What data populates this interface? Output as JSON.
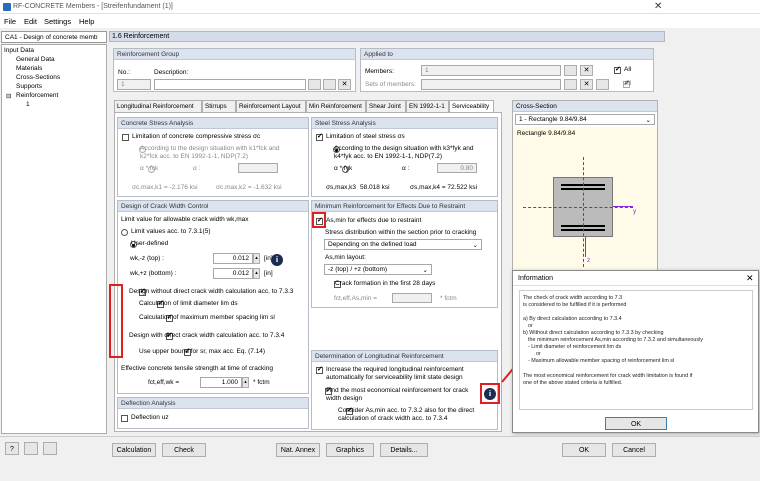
{
  "window": {
    "title": "RF-CONCRETE Members - [Streifenfundament (1)]"
  },
  "menu": [
    "File",
    "Edit",
    "Settings",
    "Help"
  ],
  "nav": {
    "case": "CA1 - Design of concrete memb",
    "tree": [
      "Input Data",
      "General Data",
      "Materials",
      "Cross-Sections",
      "Supports",
      "Reinforcement",
      "1"
    ]
  },
  "header": "1.6 Reinforcement",
  "reinf_group": {
    "title": "Reinforcement Group",
    "no_label": "No.:",
    "desc_label": "Description:",
    "no_value": "1"
  },
  "applied": {
    "title": "Applied to",
    "members_label": "Members:",
    "members_value": "1",
    "sets_label": "Sets of members:",
    "all1": "All",
    "all2": "All"
  },
  "tabs": [
    "Longitudinal Reinforcement",
    "Stirrups",
    "Reinforcement Layout",
    "Min Reinforcement",
    "Shear Joint",
    "EN 1992-1-1",
    "Serviceability"
  ],
  "ccs": {
    "title": "Concrete Stress Analysis",
    "limit": "Limitation of concrete compressive stress σc",
    "opt1a": "According to the design situation with k1*fck and",
    "opt1b": "k2*fck acc. to EN 1992-1-1, NDP(7.2)",
    "opt2": "α * fck",
    "alpha": "α :",
    "smax1": "σc,max,k1 = -2.176 ksi",
    "smax2": "σc,max,k2 = -1.632 ksi"
  },
  "ssa": {
    "title": "Steel Stress Analysis",
    "limit": "Limitation of steel stress σs",
    "opt1a": "According to the design situation with k3*fyk and",
    "opt1b": "k4*fyk acc. to EN 1992-1-1, NDP(7.2)",
    "opt2": "α * fyk",
    "alpha": "α :",
    "alpha_val": "0.80",
    "smax1": "σs,max,k3",
    "smax1v": "58.018 ksi",
    "smax2": "σs,max,k4 = 72.522 ksi"
  },
  "dcw": {
    "title": "Design of Crack Width Control",
    "limit": "Limit value for allowable crack width wk,max",
    "opt1": "Limit values acc. to 7.3.1(5)",
    "opt2": "User-defined",
    "wtop": "wk,-z (top) :",
    "wtop_v": "0.012",
    "wbot": "wk,+z (bottom) :",
    "wbot_v": "0.012",
    "unit": "[in]",
    "d1": "Design without direct crack width calculation acc. to 7.3.3",
    "d1a": "Calculation of limit diameter lim ds",
    "d1b": "Calculation of maximum member spacing lim sl",
    "d2": "Design with direct crack width calculation acc. to 7.3.4",
    "d2a": "Use upper bound for sr, max acc. Eq. (7.14)",
    "tensile": "Effective concrete tensile strength at time of cracking",
    "fct": "fct,eff,wk =",
    "fct_v": "1.000",
    "fctm": "* fctm"
  },
  "defl": {
    "title": "Deflection Analysis",
    "chk": "Deflection uz"
  },
  "minr": {
    "title": "Minimum Reinforcement for Effects Due to Restraint",
    "chk": "As,min for effects due to restraint",
    "dist": "Stress distribution within the section prior to cracking",
    "dist_v": "Depending on the defined load",
    "layout": "As,min layout:",
    "layout_v": "-z (top) / +z (bottom)",
    "crack28": "Crack formation in the first 28 days",
    "fct28": "fct,eff,As,min =",
    "fct28u": "* fctm"
  },
  "dlr": {
    "title": "Determination of Longitudinal Reinforcement",
    "c1a": "Increase the required longitudinal reinforcement",
    "c1b": "automatically for serviceability limit state design",
    "c2a": "Find the most economical reinforcement for crack",
    "c2b": "width design",
    "c3a": "Consider As,min acc. to 7.3.2 also for the direct",
    "c3b": "calculation of crack width acc. to 7.3.4"
  },
  "cs": {
    "title": "Cross-Section",
    "select": "1 - Rectangle 9.84/9.84",
    "name": "Rectangle 9.84/9.84",
    "ylab": "y",
    "zlab": "z"
  },
  "dialog": {
    "title": "Information",
    "lines": [
      "The check of crack width according to 7.3",
      "is considered to be fulfilled if it is performed",
      "a) By direct calculation according to 7.3.4",
      "or",
      "b) Without direct calculation according to 7.3.3 by checking",
      "the minimum reinforcement As,min according to 7.3.2 and simultaneously",
      "- Limit diameter of reinforcement lim ds",
      "or",
      "- Maximum allowable member spacing of reinforcement lim sl",
      "The most economical reinforcement for crack width limitation is found if",
      "one of the above stated criteria is fulfilled."
    ],
    "ok": "OK"
  },
  "bottom": {
    "calc": "Calculation",
    "check": "Check",
    "nat": "Nat. Annex",
    "graphics": "Graphics",
    "details": "Details...",
    "ok": "OK",
    "cancel": "Cancel"
  }
}
